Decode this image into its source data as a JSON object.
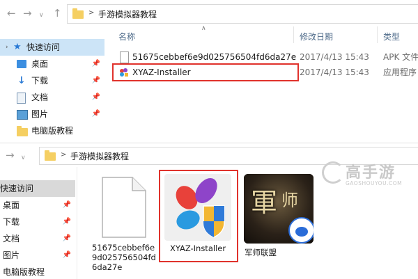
{
  "top": {
    "breadcrumb": {
      "current": "手游模拟器教程"
    },
    "sidebar": {
      "items": [
        {
          "label": "快速访问"
        },
        {
          "label": "桌面"
        },
        {
          "label": "下载"
        },
        {
          "label": "文档"
        },
        {
          "label": "图片"
        },
        {
          "label": "电脑版教程"
        }
      ]
    },
    "columns": {
      "name": "名称",
      "date": "修改日期",
      "type": "类型"
    },
    "files": [
      {
        "name": "51675cebbef6e9d025756504fd6da27e",
        "date": "2017/4/13 15:43",
        "type": "APK 文件"
      },
      {
        "name": "XYAZ-Installer",
        "date": "2017/4/13 15:43",
        "type": "应用程序"
      }
    ]
  },
  "bottom": {
    "breadcrumb": {
      "current": "手游模拟器教程"
    },
    "sidebar": {
      "items": [
        {
          "label": "快速访问"
        },
        {
          "label": "桌面"
        },
        {
          "label": "下载"
        },
        {
          "label": "文档"
        },
        {
          "label": "图片"
        },
        {
          "label": "电脑版教程"
        }
      ]
    },
    "tiles": [
      {
        "line1": "51675cebbef6e",
        "line2": "9d025756504fd",
        "line3": "6da27e"
      },
      {
        "label": "XYAZ-Installer"
      },
      {
        "label": "军师联盟"
      }
    ]
  },
  "watermark": {
    "brand": "高手游",
    "domain": "GAOSHOUYOU.COM"
  },
  "colors": {
    "selection": "#cce4f7",
    "highlight": "#e0322c",
    "folder": "#f5cf62"
  }
}
